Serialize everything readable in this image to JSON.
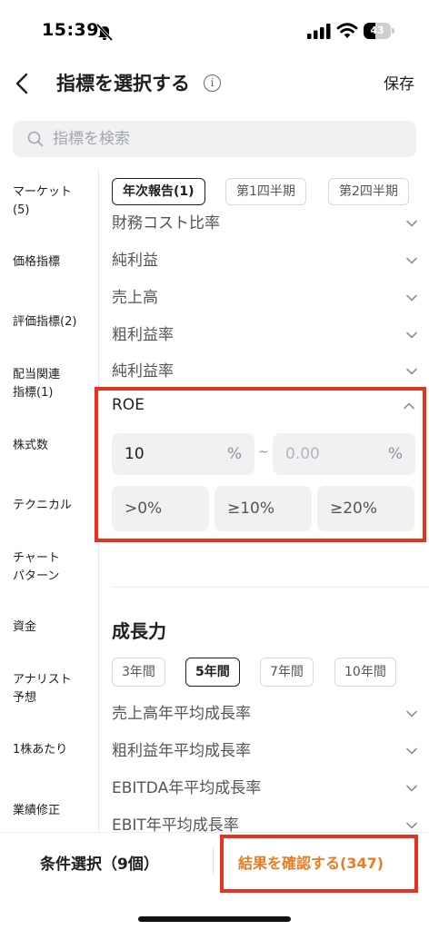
{
  "status_bar": {
    "time": "15:39",
    "battery": "43",
    "battery_level": 0.43
  },
  "header": {
    "title": "指標を選択する",
    "save": "保存"
  },
  "search": {
    "placeholder": "指標を検索"
  },
  "sidebar": {
    "items": [
      {
        "label": "マーケット\n(5)"
      },
      {
        "label": "価格指標"
      },
      {
        "label": "評価指標(2)"
      },
      {
        "label": "配当関連\n指標(1)"
      },
      {
        "label": "株式数"
      },
      {
        "label": "テクニカル"
      },
      {
        "label": "チャート\nパターン"
      },
      {
        "label": "資金"
      },
      {
        "label": "アナリスト\n予想"
      },
      {
        "label": "1株あたり"
      },
      {
        "label": "業績修正"
      }
    ]
  },
  "period_tabs": [
    {
      "label": "年次報告(1)",
      "active": true
    },
    {
      "label": "第1四半期",
      "active": false
    },
    {
      "label": "第2四半期",
      "active": false
    }
  ],
  "indicators": [
    {
      "label": "財務コスト比率"
    },
    {
      "label": "純利益"
    },
    {
      "label": "売上高"
    },
    {
      "label": "粗利益率"
    },
    {
      "label": "純利益率"
    }
  ],
  "roe": {
    "label": "ROE",
    "min_value": "10",
    "min_unit": "%",
    "separator": "~",
    "max_placeholder": "0.00",
    "max_unit": "%",
    "presets": [
      {
        "label": ">0%"
      },
      {
        "label": "≥10%"
      },
      {
        "label": "≥20%"
      }
    ]
  },
  "growth": {
    "title": "成長力",
    "year_tabs": [
      {
        "label": "3年間",
        "active": false
      },
      {
        "label": "5年間",
        "active": true
      },
      {
        "label": "7年間",
        "active": false
      },
      {
        "label": "10年間",
        "active": false
      }
    ],
    "indicators": [
      {
        "label": "売上高年平均成長率"
      },
      {
        "label": "粗利益年平均成長率"
      },
      {
        "label": "EBITDA年平均成長率"
      },
      {
        "label": "EBIT年平均成長率"
      }
    ]
  },
  "bottom": {
    "conditions": "条件選択（9個）",
    "result": "結果を確認する(347)"
  },
  "colors": {
    "highlight": "#e8321e",
    "accent": "#ee7a1f"
  }
}
